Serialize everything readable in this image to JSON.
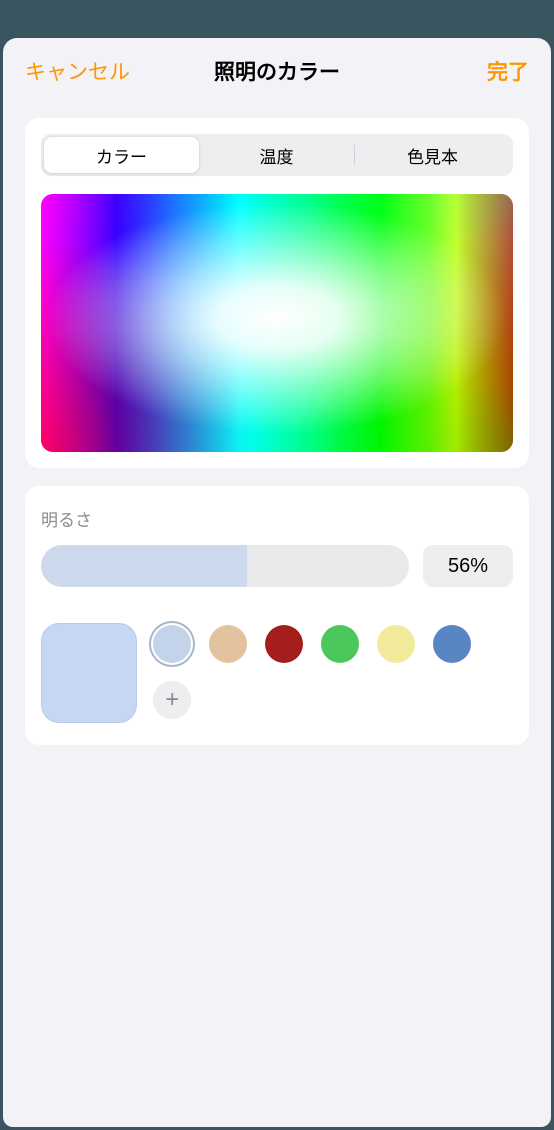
{
  "nav": {
    "cancel": "キャンセル",
    "title": "照明のカラー",
    "done": "完了"
  },
  "tabs": {
    "color": "カラー",
    "temperature": "温度",
    "swatches": "色見本",
    "active": "color"
  },
  "brightness": {
    "label": "明るさ",
    "value": 56,
    "display": "56%"
  },
  "current_swatch": "#c6d7f5",
  "swatches": [
    {
      "color": "#c3d4ea",
      "selected": true
    },
    {
      "color": "#e3c39e",
      "selected": false
    },
    {
      "color": "#a41f1c",
      "selected": false
    },
    {
      "color": "#4cc85a",
      "selected": false
    },
    {
      "color": "#f1ea9a",
      "selected": false
    },
    {
      "color": "#5a85c4",
      "selected": false
    }
  ],
  "add_icon": "+"
}
